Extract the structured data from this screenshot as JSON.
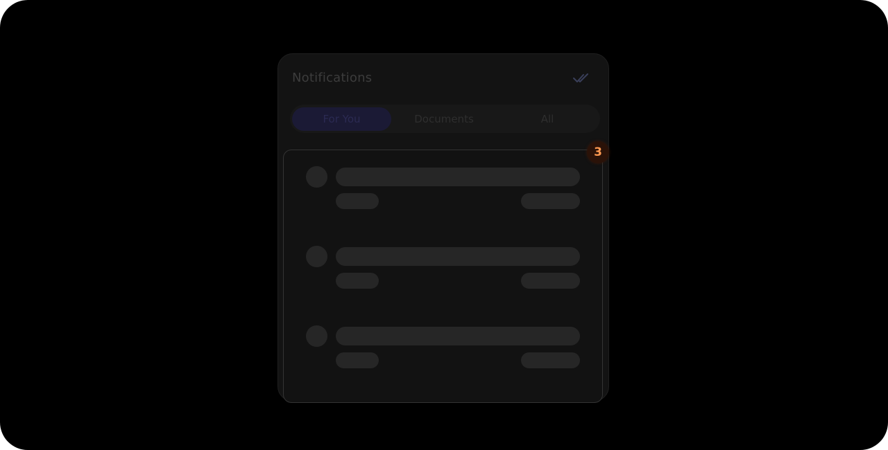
{
  "panel": {
    "title": "Notifications",
    "mark_all_read_icon": "double-check-icon"
  },
  "tabs": [
    {
      "label": "For You",
      "active": true
    },
    {
      "label": "Documents",
      "active": false
    },
    {
      "label": "All",
      "active": false
    }
  ],
  "notifications": {
    "state": "loading",
    "skeleton_rows": 3
  },
  "step_badge": {
    "label": "3",
    "color": "#ff9a52"
  },
  "colors": {
    "background": "#000000",
    "panel": "#131313",
    "skeleton": "#262626",
    "active_tab": "#1b1a35"
  }
}
